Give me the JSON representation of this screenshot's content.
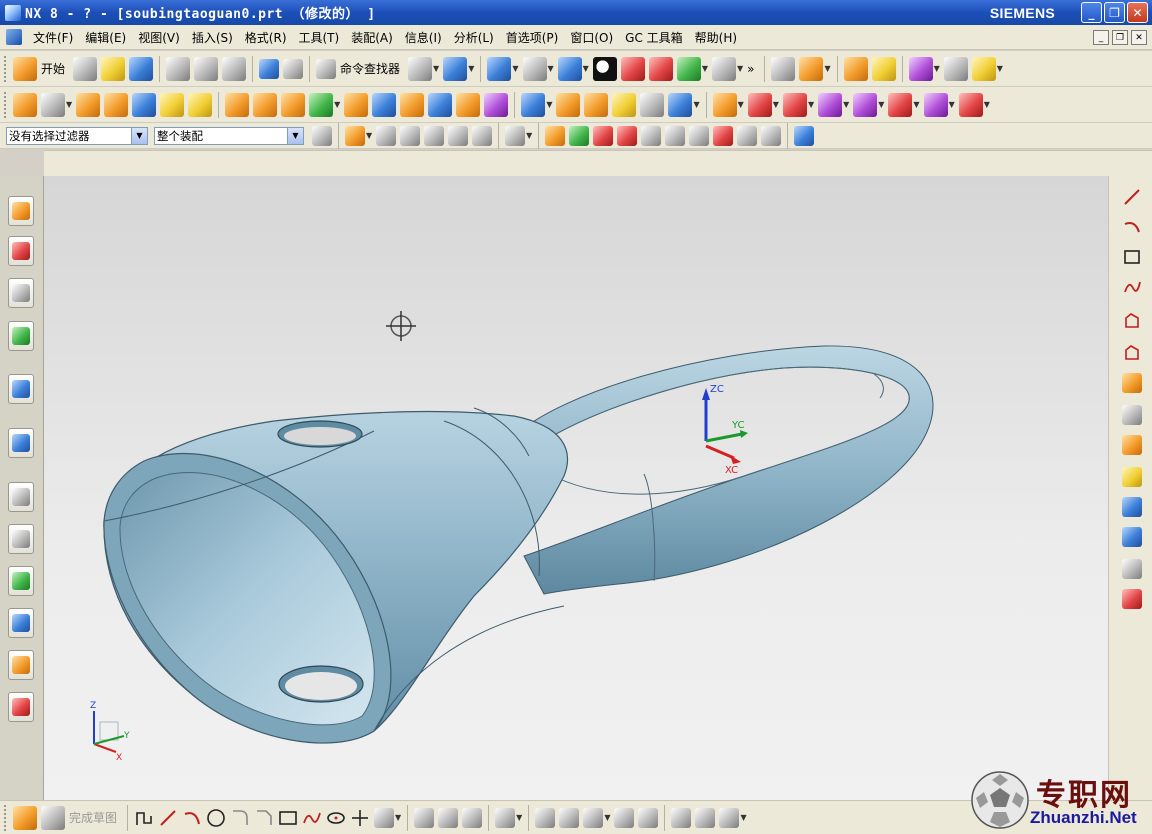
{
  "window": {
    "title": "NX 8 - ? - [soubingtaoguan0.prt （修改的） ]",
    "brand": "SIEMENS",
    "controls": {
      "minimize": "_",
      "maximize": "❐",
      "close": "✕"
    }
  },
  "menubar": {
    "items": [
      "文件(F)",
      "编辑(E)",
      "视图(V)",
      "插入(S)",
      "格式(R)",
      "工具(T)",
      "装配(A)",
      "信息(I)",
      "分析(L)",
      "首选项(P)",
      "窗口(O)",
      "GC 工具箱",
      "帮助(H)"
    ]
  },
  "toolbar_standard": {
    "start_label": "开始",
    "command_finder_label": "命令查找器",
    "overflow_label": "»"
  },
  "selection_bar": {
    "filter_value": "没有选择过滤器",
    "scope_value": "整个装配"
  },
  "sketch_bar": {
    "finish_sketch_label": "完成草图"
  },
  "viewport": {
    "wcs_labels": {
      "zc": "ZC",
      "yc": "YC",
      "xc": "XC"
    },
    "triad_labels": {
      "z": "Z",
      "y": "Y",
      "x": "X"
    },
    "model_color": "#8fb4c8"
  },
  "watermark": {
    "chinese": "专职网",
    "site": "Zhuanzhi.Net"
  }
}
